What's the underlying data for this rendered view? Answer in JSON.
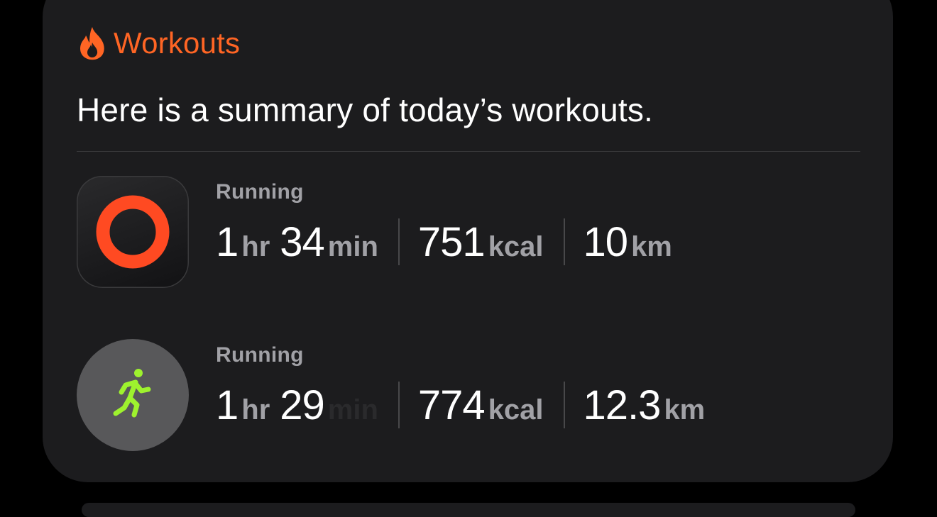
{
  "colors": {
    "accent": "#ff6524",
    "card_bg": "#1c1c1e",
    "ring": "#ff4a22",
    "runner": "#9ef22e",
    "secondary_text": "#a1a1a6"
  },
  "header": {
    "icon": "flame-icon",
    "label": "Workouts"
  },
  "summary": "Here is a summary of today’s workouts.",
  "workouts": [
    {
      "icon": "activity-ring-icon",
      "activity": "Running",
      "duration": {
        "hours": "1",
        "hours_unit": "hr",
        "minutes": "34",
        "minutes_unit": "min"
      },
      "energy": {
        "value": "751",
        "unit": "kcal"
      },
      "distance": {
        "value": "10",
        "unit": "km"
      }
    },
    {
      "icon": "running-figure-icon",
      "activity": "Running",
      "duration": {
        "hours": "1",
        "hours_unit": "hr",
        "minutes": "29",
        "minutes_unit": "min"
      },
      "energy": {
        "value": "774",
        "unit": "kcal"
      },
      "distance": {
        "value": "12.3",
        "unit": "km"
      }
    }
  ]
}
